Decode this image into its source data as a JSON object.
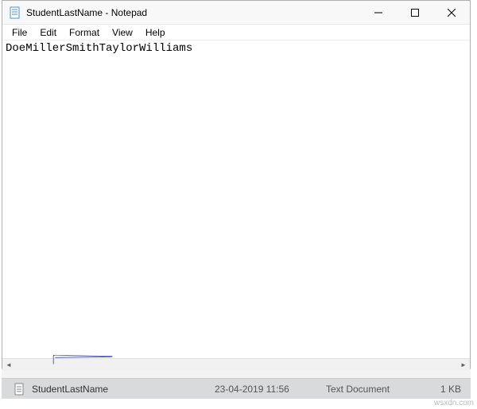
{
  "titlebar": {
    "title": "StudentLastName - Notepad"
  },
  "menubar": {
    "items": [
      "File",
      "Edit",
      "Format",
      "View",
      "Help"
    ]
  },
  "editor": {
    "content": "DoeMillerSmithTaylorWilliams"
  },
  "file_row_prev": {
    "date_partial": "",
    "type_partial": ""
  },
  "file_row": {
    "name": "StudentLastName",
    "date": "23-04-2019 11:56",
    "type": "Text Document",
    "size": "1 KB"
  },
  "watermark": "wsxdn.com"
}
